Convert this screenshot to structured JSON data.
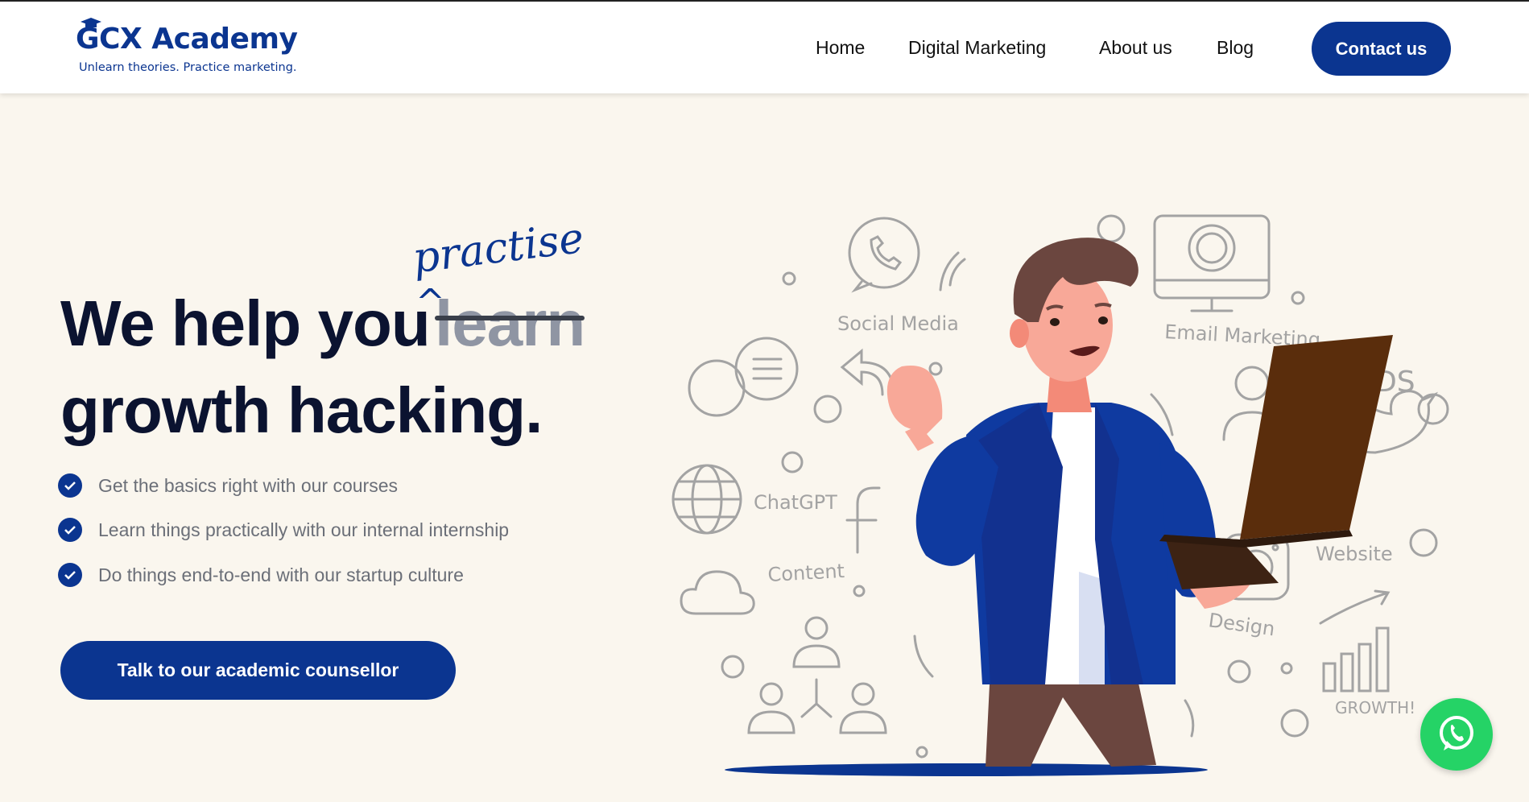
{
  "brand": {
    "name": "GCX Academy",
    "tagline": "Unlearn theories. Practice marketing."
  },
  "nav": {
    "items": [
      "Home",
      "Digital Marketing",
      "About us",
      "Blog"
    ],
    "contact_label": "Contact us"
  },
  "hero": {
    "line1": "We help you",
    "struck_word": "learn",
    "handwritten_word": "practise",
    "line2": "growth hacking.",
    "bullets": [
      "Get the basics right with our courses",
      "Learn things practically with our internal internship",
      "Do things end-to-end with our startup culture"
    ],
    "cta_label": "Talk to our academic counsellor"
  },
  "illustration": {
    "labels": [
      "Social Media",
      "Email Marketing",
      "Paid ADS",
      "ChatGPT",
      "Content",
      "Website",
      "Design",
      "GROWTH!"
    ]
  },
  "colors": {
    "brand_blue": "#0b3590",
    "hero_bg": "#faf6ee",
    "whatsapp_green": "#25d366",
    "doodle_gray": "#a3a3a3"
  },
  "icons": {
    "whatsapp": "whatsapp-icon",
    "check": "check-circle-icon"
  }
}
